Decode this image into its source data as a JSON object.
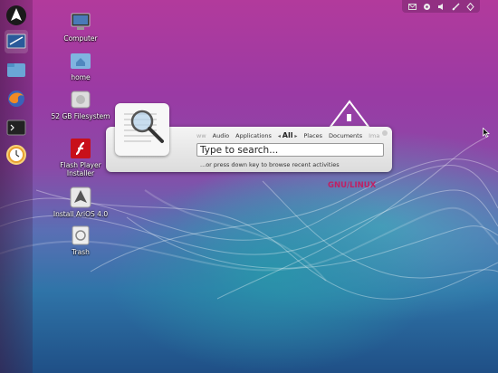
{
  "launcher": {
    "items": [
      {
        "name": "arios-logo"
      },
      {
        "name": "screenshot-app"
      },
      {
        "name": "home-folder"
      },
      {
        "name": "firefox"
      },
      {
        "name": "terminal"
      },
      {
        "name": "clock"
      }
    ]
  },
  "panel": {
    "icons": [
      "mail-icon",
      "gear-icon",
      "volume-icon",
      "network-icon",
      "settings-icon"
    ]
  },
  "desktop": {
    "computer_label": "Computer",
    "home_label": "home",
    "filesystem_label": "52 GB Filesystem",
    "flash_label_1": "Flash Player",
    "flash_label_2": "Installer",
    "install_label": "Install AriOS 4.0",
    "trash_label": "Trash"
  },
  "dash": {
    "tabs": {
      "hidden": "ww",
      "audio": "Audio",
      "applications": "Applications",
      "all": "All",
      "places": "Places",
      "documents": "Documents",
      "more": "Ima"
    },
    "search_placeholder": "Type to search...",
    "hint": "...or press down key to browse recent activities"
  },
  "wallpaper": {
    "brand": "GNU/LINUX"
  },
  "colors": {
    "brand_red": "#c02063",
    "wallpaper_top": "#b23a9c",
    "wallpaper_bottom": "#1f4f86"
  }
}
